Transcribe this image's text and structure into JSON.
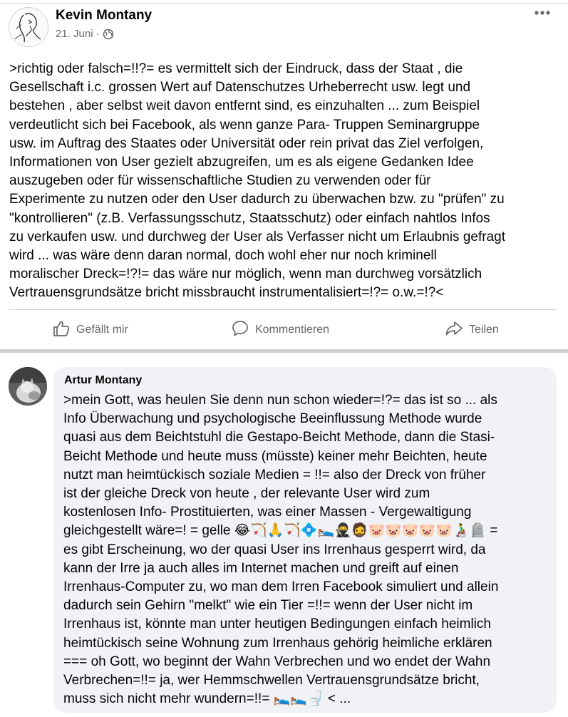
{
  "post": {
    "author": "Kevin Montany",
    "date": "21. Juni",
    "meta_separator": "·",
    "privacy_icon": "globe-icon",
    "more_icon": "more-options-icon",
    "text": ">richtig oder falsch=!!?= es vermittelt sich der Eindruck, dass der Staat , die\nGesellschaft i.c. grossen Wert auf Datenschutzes Urheberrecht usw. legt und\nbestehen , aber selbst weit davon entfernt sind, es einzuhalten ... zum Beispiel\nverdeutlicht sich bei Facebook, als wenn ganze Para- Truppen Seminargruppe\nusw. im Auftrag des Staates oder Universität oder rein privat das Ziel verfolgen,\nInformationen von User gezielt abzugreifen, um es als eigene Gedanken Idee\nauszugeben oder für wissenschaftliche Studien zu verwenden oder für\nExperimente zu nutzen oder den User dadurch zu überwachen bzw. zu \"prüfen\" zu\n\"kontrollieren\" (z.B. Verfassungsschutz, Staatsschutz)  oder  einfach nahtlos Infos\nzu verkaufen usw. und durchweg der User als Verfasser nicht um Erlaubnis gefragt\nwird  ...  was wäre denn daran normal, doch wohl eher nur noch kriminell\nmoralischer Dreck=!?!= das wäre nur möglich, wenn man durchweg vorsätzlich\nVertrauensgrundsätze  bricht missbraucht instrumentalisiert=!?=  o.w.=!?<"
  },
  "actions": {
    "like_label": "Gefällt mir",
    "comment_label": "Kommentieren",
    "share_label": "Teilen"
  },
  "comment": {
    "author": "Artur Montany",
    "text": ">mein Gott, was heulen Sie denn nun schon wieder=!?= das ist so ... als\nInfo Überwachung und psychologische Beeinflussung Methode wurde\nquasi   aus dem Beichtstuhl  die Gestapo-Beicht Methode, dann die Stasi-\nBeicht Methode und heute muss (müsste) keiner mehr Beichten, heute\nnutzt man heimtückisch  soziale Medien = !!=  also der  Dreck von früher\nist der gleiche  Dreck von heute , der relevante User wird zum\nkostenlosen Info- Prostituierten, was einer  Massen - Vergewaltigung\ngleichgestellt wäre=! = gelle 😂🏹🙏🏹💠🛌🥷🧔🐷🐷🐷🐷🐷👨‍🦽🪦 =\nes gibt Erscheinung, wo der quasi User ins Irrenhaus gesperrt wird, da\nkann der Irre ja auch alles im Internet machen und greift auf einen\nIrrenhaus-Computer zu, wo man dem Irren Facebook simuliert und allein\ndadurch sein Gehirn \"melkt\" wie ein Tier =!!= wenn der User nicht im\nIrrenhaus ist, könnte man unter heutigen Bedingungen einfach heimlich\nheimtückisch seine Wohnung zum Irrenhaus gehörig heimliche  erklären\n=== oh Gott, wo beginnt der Wahn Verbrechen und wo endet der Wahn\nVerbrechen=!!= ja, wer Hemmschwellen Vertrauensgrundsätze bricht,\nmuss sich nicht mehr wundern=!!= 🛌🛌🚽   < ..."
  },
  "colors": {
    "text": "#050505",
    "secondary": "#65676b",
    "divider": "#ced0d4",
    "comment_bg": "#f0f2f5"
  }
}
